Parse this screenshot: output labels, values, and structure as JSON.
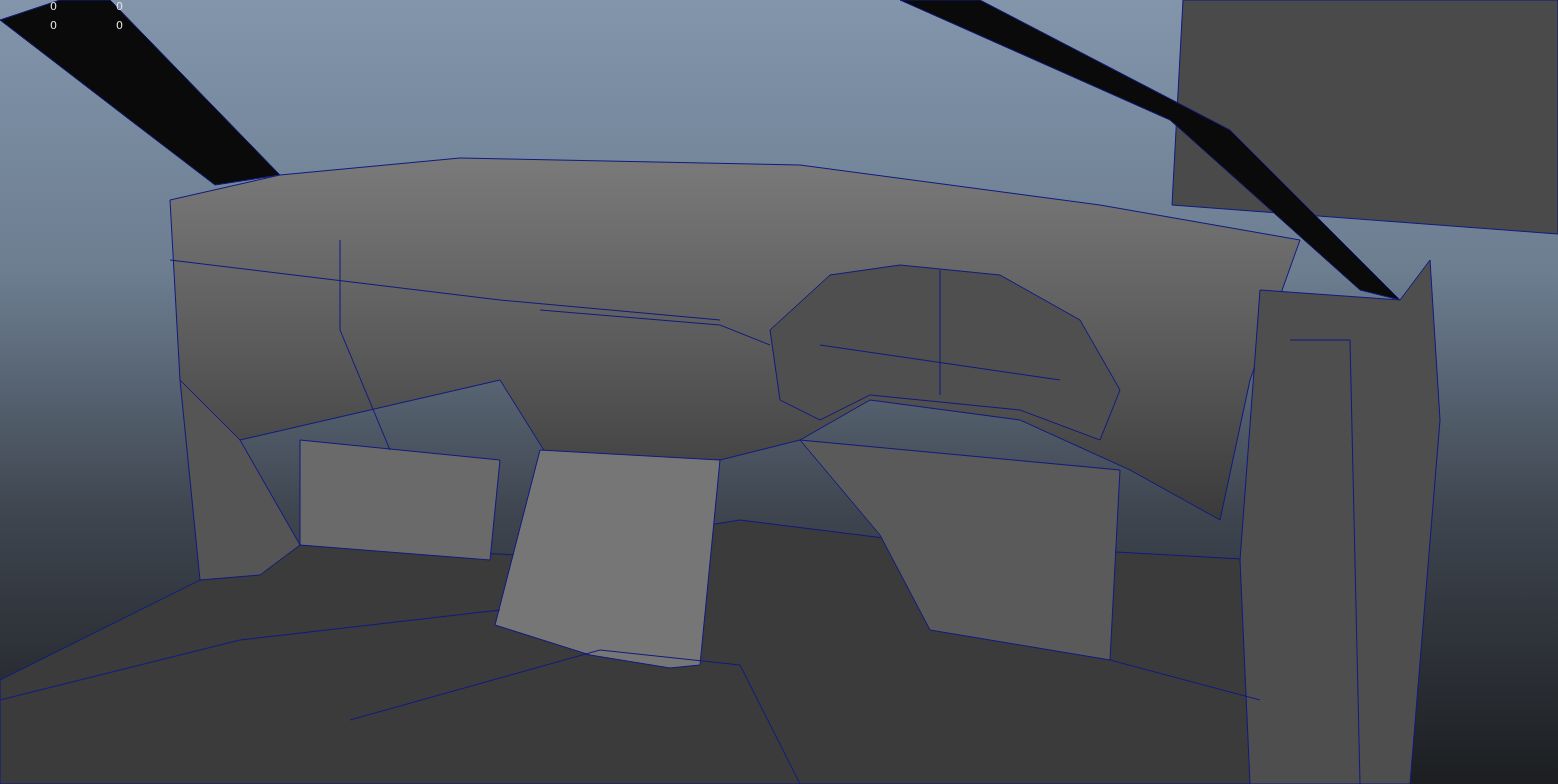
{
  "viewport": {
    "hud": {
      "rows": [
        {
          "cells": [
            "0",
            "0"
          ]
        },
        {
          "cells": [
            "0",
            "0"
          ]
        }
      ]
    }
  }
}
